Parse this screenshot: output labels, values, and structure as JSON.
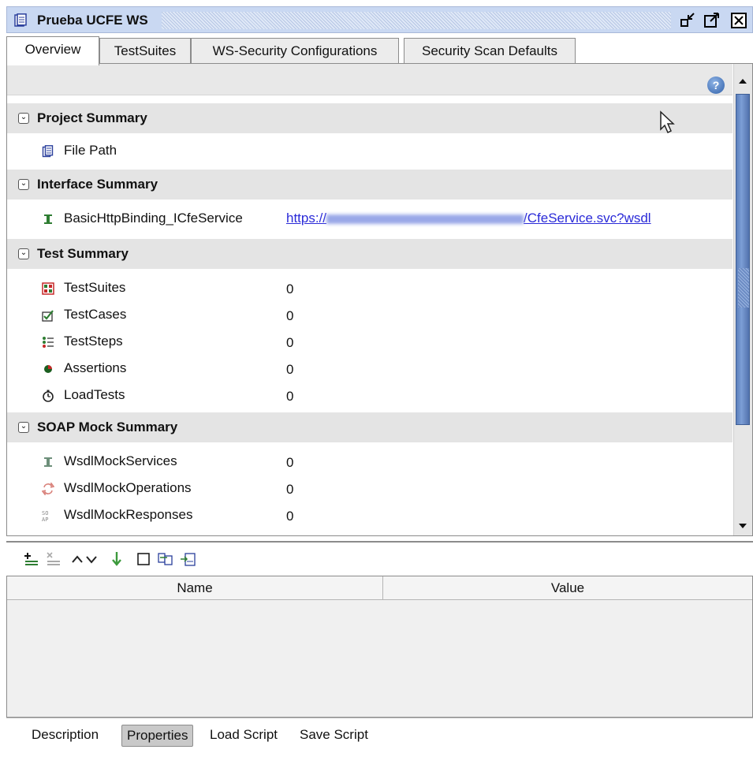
{
  "window": {
    "title": "Prueba UCFE WS"
  },
  "tabs": [
    {
      "label": "Overview",
      "active": true
    },
    {
      "label": "TestSuites",
      "active": false
    },
    {
      "label": "WS-Security Configurations",
      "active": false
    },
    {
      "label": "Security Scan Defaults",
      "active": false
    }
  ],
  "sections": {
    "project": {
      "title": "Project Summary",
      "rows": [
        {
          "label": "File Path",
          "icon": "project-file-icon"
        }
      ]
    },
    "interface": {
      "title": "Interface Summary",
      "rows": [
        {
          "label": "BasicHttpBinding_ICfeService",
          "url_prefix": "https://",
          "url_suffix": "/CfeService.svc?wsdl",
          "icon": "interface-icon"
        }
      ]
    },
    "test": {
      "title": "Test Summary",
      "rows": [
        {
          "label": "TestSuites",
          "value": "0",
          "icon": "testsuite-icon"
        },
        {
          "label": "TestCases",
          "value": "0",
          "icon": "testcase-icon"
        },
        {
          "label": "TestSteps",
          "value": "0",
          "icon": "teststeps-icon"
        },
        {
          "label": "Assertions",
          "value": "0",
          "icon": "assertion-icon"
        },
        {
          "label": "LoadTests",
          "value": "0",
          "icon": "loadtest-icon"
        }
      ]
    },
    "mock": {
      "title": "SOAP Mock Summary",
      "rows": [
        {
          "label": "WsdlMockServices",
          "value": "0",
          "icon": "mock-service-icon"
        },
        {
          "label": "WsdlMockOperations",
          "value": "0",
          "icon": "mock-operation-icon"
        },
        {
          "label": "WsdlMockResponses",
          "value": "0",
          "icon": "mock-response-icon"
        }
      ]
    }
  },
  "properties": {
    "columns": [
      "Name",
      "Value"
    ]
  },
  "bottom_tabs": [
    {
      "label": "Description",
      "active": false
    },
    {
      "label": "Properties",
      "active": true
    },
    {
      "label": "Load Script",
      "active": false
    },
    {
      "label": "Save Script",
      "active": false
    }
  ],
  "colors": {
    "accent": "#5b7fbc",
    "link": "#2a2ad8",
    "titlebar": "#c9d8f2"
  }
}
